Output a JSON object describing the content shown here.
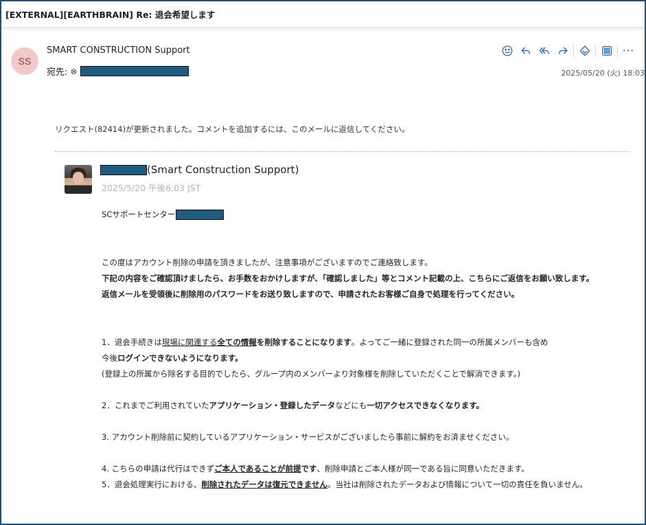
{
  "email": {
    "subject": "[EXTERNAL][EARTHBRAIN] Re: 退会希望します",
    "sender_initials": "SS",
    "sender_name": "SMART CONSTRUCTION Support",
    "to_label": "宛先:",
    "date": "2025/05/20 (火) 18:03"
  },
  "toolbar": {
    "icons": [
      "smiley-icon",
      "reply-icon",
      "reply-all-icon",
      "forward-icon",
      "immersive-reader-icon",
      "apps-icon",
      "more-icon"
    ],
    "more_label": "···"
  },
  "body": {
    "intro": "リクエスト(82414)が更新されました。コメントを追加するには、このメールに返信してください。",
    "agent": {
      "name_suffix": "(Smart Construction Support)",
      "date": "2025/5/20 午後6:03 JST"
    },
    "sc_label": "SCサポートセンター",
    "para1": "この度はアカウント削除の申請を頂きましたが、注意事項がございますのでご連絡致します。",
    "para2": "下記の内容をご確認頂けましたら、お手数をおかけしますが、「確認しました」等とコメント記載の上、こちらにご返信をお願い致します。",
    "para3": "返信メールを受領後に削除用のパスワードをお送り致しますので、申請されたお客様ご自身で処理を行ってください。",
    "item1": {
      "a": "1．退会手続きは",
      "b": "現場に関連する",
      "c": "全ての情報",
      "d": "を削除することになります",
      "e": "。よってご一緒に登録された同一の所属メンバーも含め"
    },
    "item1_line2": {
      "a": "今後",
      "b": "ログインできないようになります。"
    },
    "item1_line3": "(登録上の所属から除名する目的でしたら、グループ内のメンバーより対象様を削除していただくことで解消できます。)",
    "item2": {
      "a": "2．これまでご利用されていた",
      "b": "アプリケーション・登録したデータ",
      "c": "などにも",
      "d": "一切アクセスできなくなります。"
    },
    "item3": "3. アカウント削除前に契約しているアプリケーション・サービスがございましたら事前に解約をお済ませください。",
    "item4": {
      "a": "4. こちらの申請は代行はできず",
      "b": "ご本人であることが前提",
      "c": "です",
      "d": "、削除申請とご本人様が同一である旨に同意いただきます。"
    },
    "item5": {
      "a": "5．退会処理実行における、",
      "b": "削除されたデータは復元できません",
      "c": "。当社は削除されたデータおよび情報について一切の責任を負いません。"
    }
  }
}
